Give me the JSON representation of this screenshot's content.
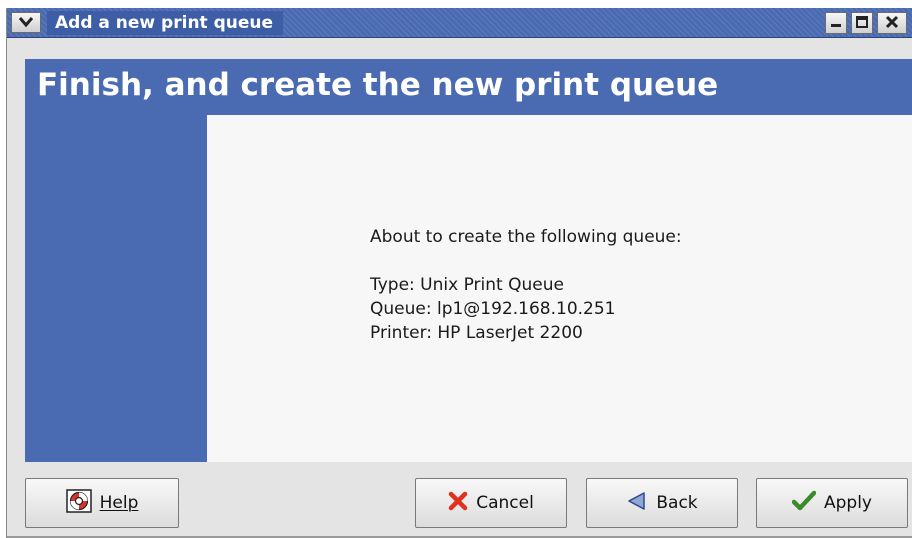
{
  "window": {
    "title": "Add a new print queue",
    "menu_icon": "chevron-down-icon",
    "controls": {
      "minimize_icon": "minimize-icon",
      "maximize_icon": "maximize-icon",
      "close_icon": "close-icon"
    }
  },
  "header": {
    "title": "Finish, and create the new print queue"
  },
  "summary": {
    "intro": "About to create the following queue:",
    "type_line": "Type: Unix Print Queue",
    "queue_line": "Queue: lp1@192.168.10.251",
    "printer_line": "Printer: HP LaserJet 2200"
  },
  "buttons": {
    "help": {
      "label": "Help",
      "icon": "lifebuoy-icon"
    },
    "cancel": {
      "label": "Cancel",
      "icon": "x-icon"
    },
    "back": {
      "label": "Back",
      "icon": "left-triangle-icon"
    },
    "apply": {
      "label": "Apply",
      "icon": "checkmark-icon"
    }
  },
  "colors": {
    "accent_blue": "#4a6bb2",
    "content_bg": "#f7f7f7",
    "chrome_bg": "#e4e4e4",
    "cancel_red": "#e0301e",
    "apply_green": "#3c8a2e",
    "back_blue": "#4a6bb2"
  }
}
